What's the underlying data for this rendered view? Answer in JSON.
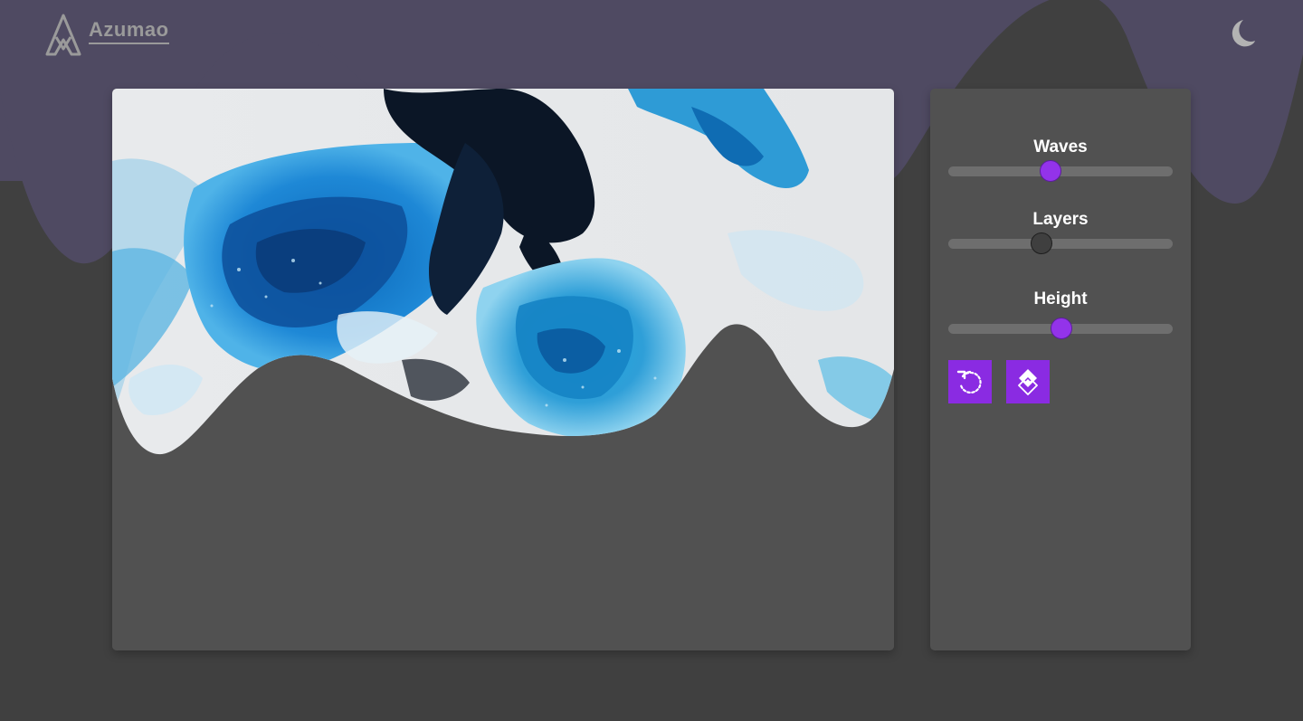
{
  "app": {
    "brand_name": "Azumao",
    "theme_icon": "moon-icon"
  },
  "colors": {
    "accent": "#9333ea",
    "header_band": "#4f4a62",
    "background": "#404040",
    "card": "#515151"
  },
  "controls": {
    "waves": {
      "label": "Waves",
      "value_fraction": 0.45
    },
    "layers": {
      "label": "Layers",
      "value_fraction": 0.41
    },
    "height": {
      "label": "Height",
      "value_fraction": 0.5
    },
    "buttons": [
      {
        "icon": "refresh-icon"
      },
      {
        "icon": "layers-icon"
      }
    ]
  },
  "preview": {
    "image": "fluid-art-blue-abstract"
  }
}
